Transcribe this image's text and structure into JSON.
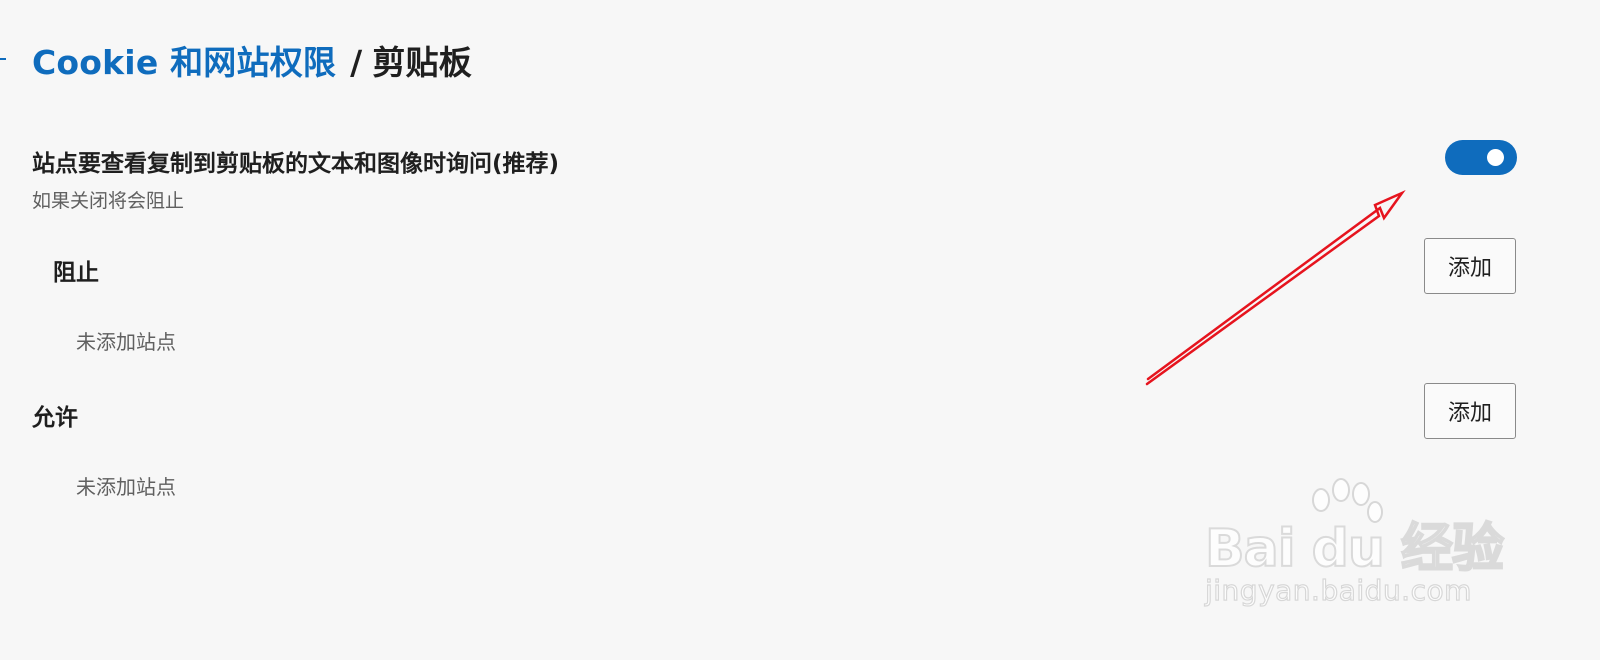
{
  "header": {
    "breadcrumb_link": "Cookie 和网站权限",
    "separator": "/",
    "current_page": "剪贴板"
  },
  "clipboard_setting": {
    "title": "站点要查看复制到剪贴板的文本和图像时询问(推荐)",
    "description": "如果关闭将会阻止",
    "toggle_on": true
  },
  "block_section": {
    "heading": "阻止",
    "add_label": "添加",
    "empty_text": "未添加站点"
  },
  "allow_section": {
    "heading": "允许",
    "add_label": "添加",
    "empty_text": "未添加站点"
  },
  "watermark": {
    "logo": "Bai du 经验",
    "url": "jingyan.baidu.com"
  },
  "colors": {
    "accent": "#0f6cbd",
    "annotation": "#e6141e"
  }
}
